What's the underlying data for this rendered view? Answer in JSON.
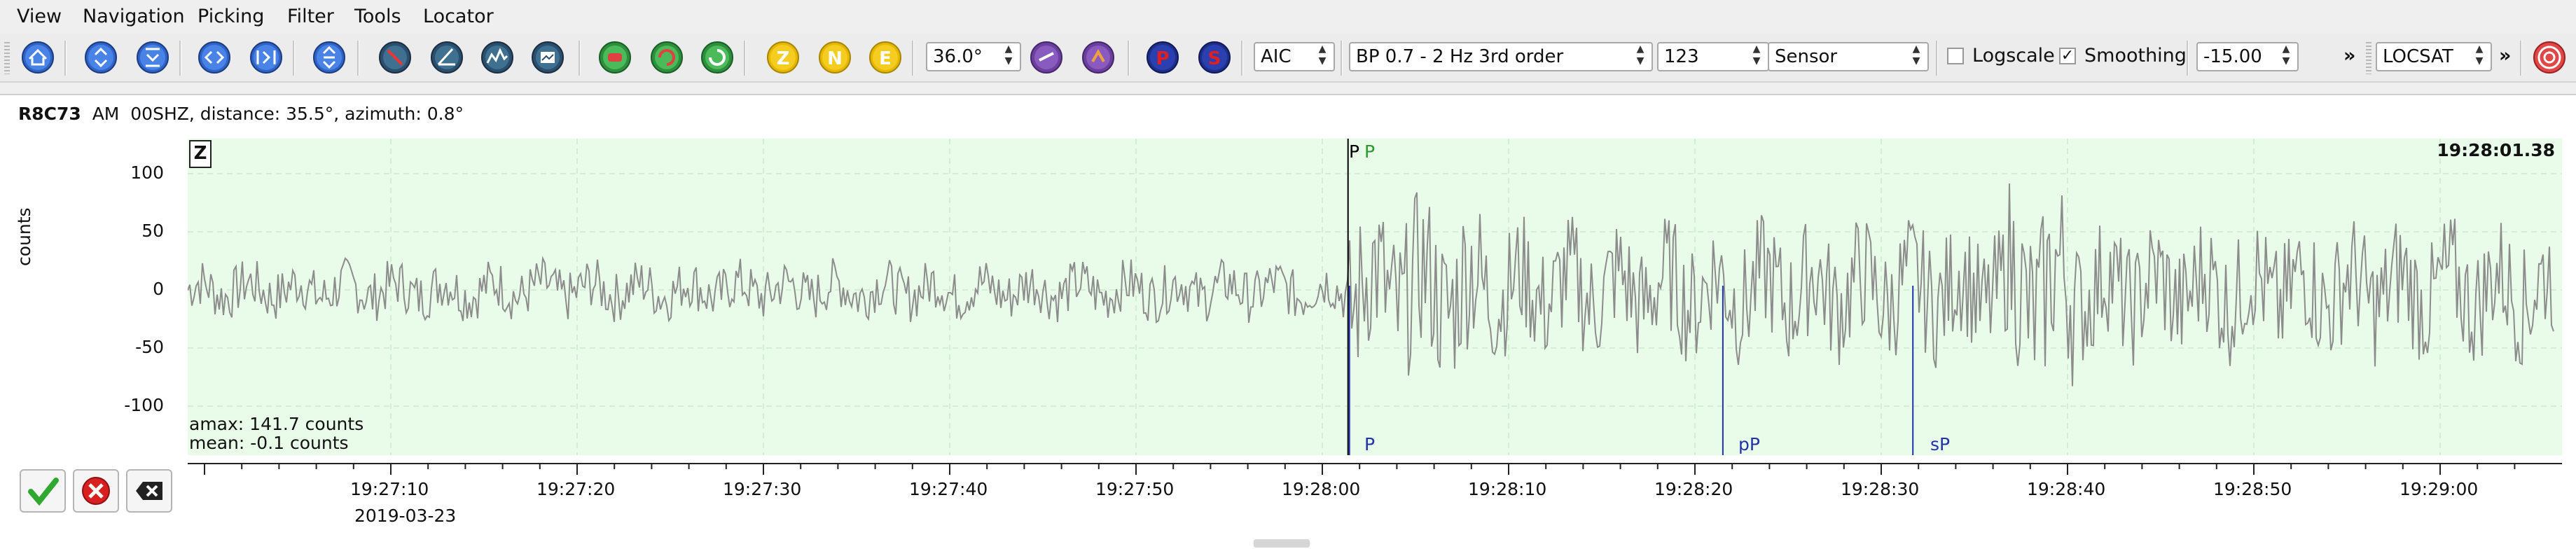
{
  "menu": {
    "items": [
      "View",
      "Navigation",
      "Picking",
      "Filter",
      "Tools",
      "Locator"
    ]
  },
  "toolbar": {
    "zoom_value": "36.0°",
    "picker": "AIC",
    "filter": "BP 0.7 - 2 Hz  3rd order",
    "channel_value": "123",
    "unit_mode": "Sensor",
    "logscale_label": "Logscale",
    "logscale_checked": false,
    "smoothing_label": "Smoothing",
    "smoothing_checked": true,
    "amplitude_value": "-15.00",
    "overflow_glyph": "»",
    "locator": "LOCSAT",
    "component_buttons": [
      "Z",
      "N",
      "E"
    ],
    "phase_buttons": [
      "P",
      "S"
    ]
  },
  "trace": {
    "station": "R8C73",
    "network": "AM",
    "channel": "00SHZ",
    "distance_text": ", distance: 35.5°, azimuth: 0.8°",
    "component": "Z",
    "time_label": "19:28:01.38",
    "ylabel": "counts",
    "yticks": [
      "100",
      "50",
      "0",
      "-50",
      "-100"
    ],
    "xticks": [
      "19:27:10",
      "19:27:20",
      "19:27:30",
      "19:27:40",
      "19:27:50",
      "19:28:00",
      "19:28:10",
      "19:28:20",
      "19:28:30",
      "19:28:40",
      "19:28:50",
      "19:29:00"
    ],
    "date": "2019-03-23",
    "amax": "amax: 141.7 counts",
    "mean": "mean: -0.1 counts",
    "picks": {
      "P_top_black": "P",
      "P_top_green": "P",
      "P_bottom": "P",
      "pP": "pP",
      "sP": "sP"
    }
  },
  "chart_data": {
    "type": "line",
    "title": "",
    "xlabel": "",
    "ylabel": "counts",
    "x_range": [
      "19:27:00",
      "19:29:05"
    ],
    "ylim": [
      -140,
      130
    ],
    "grid": true,
    "series": [
      {
        "values_description_note": ""
      }
    ],
    "picks": [
      {
        "phase": "P",
        "time": "19:28:01.38",
        "color": "#000000"
      },
      {
        "phase": "pP",
        "time": "19:28:21.5",
        "color": "#2233aa"
      },
      {
        "phase": "sP",
        "time": "19:28:31.7",
        "color": "#2233aa"
      }
    ],
    "amax": 141.7,
    "mean": -0.1
  },
  "colors": {
    "plot_bg": "#e9fbe9",
    "trace": "#8c8c8c",
    "pick_blue": "#2233aa",
    "pick_green": "#2a9a2a"
  }
}
